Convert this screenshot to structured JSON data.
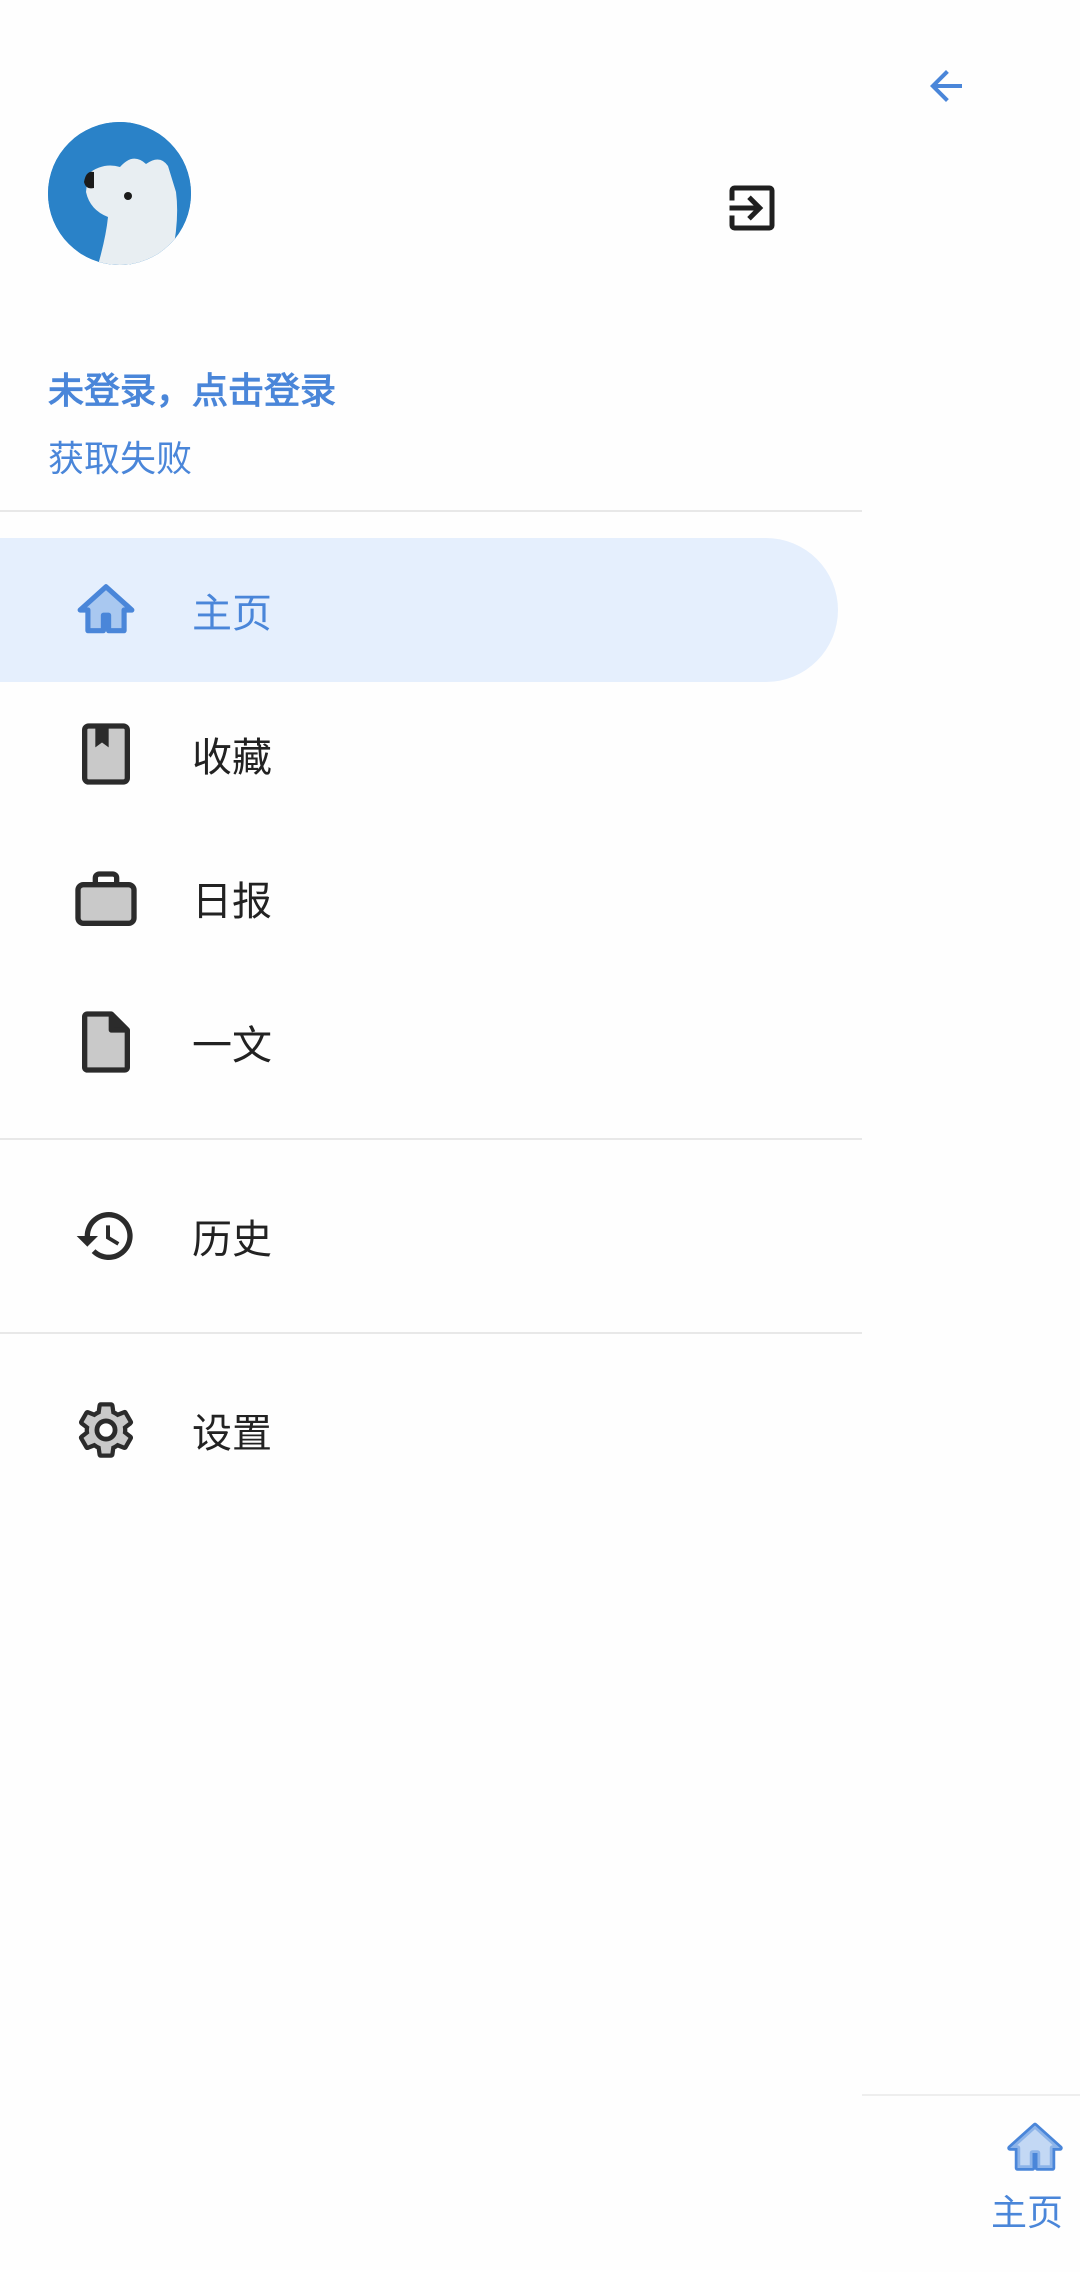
{
  "colors": {
    "accent": "#4a86d9",
    "active_background": "#e5effd",
    "icon_dark": "#2b2b2b",
    "icon_fill": "#c9c9c9",
    "avatar_background": "#2a82c8"
  },
  "header": {
    "back_icon": "arrow-left-icon",
    "logout_icon": "exit-to-app-icon",
    "avatar_icon": "polar-bear-avatar"
  },
  "user": {
    "login_prompt": "未登录，点击登录",
    "status": "获取失败"
  },
  "menu": {
    "primary": [
      {
        "label": "主页",
        "icon": "home-icon",
        "active": true
      },
      {
        "label": "收藏",
        "icon": "bookmark-book-icon",
        "active": false
      },
      {
        "label": "日报",
        "icon": "briefcase-icon",
        "active": false
      },
      {
        "label": "一文",
        "icon": "document-icon",
        "active": false
      }
    ],
    "secondary": [
      {
        "label": "历史",
        "icon": "history-icon",
        "active": false
      }
    ],
    "tertiary": [
      {
        "label": "设置",
        "icon": "settings-gear-icon",
        "active": false
      }
    ]
  },
  "bottom_nav": {
    "tabs": [
      {
        "label": "主页",
        "icon": "home-icon",
        "selected": true
      }
    ]
  }
}
